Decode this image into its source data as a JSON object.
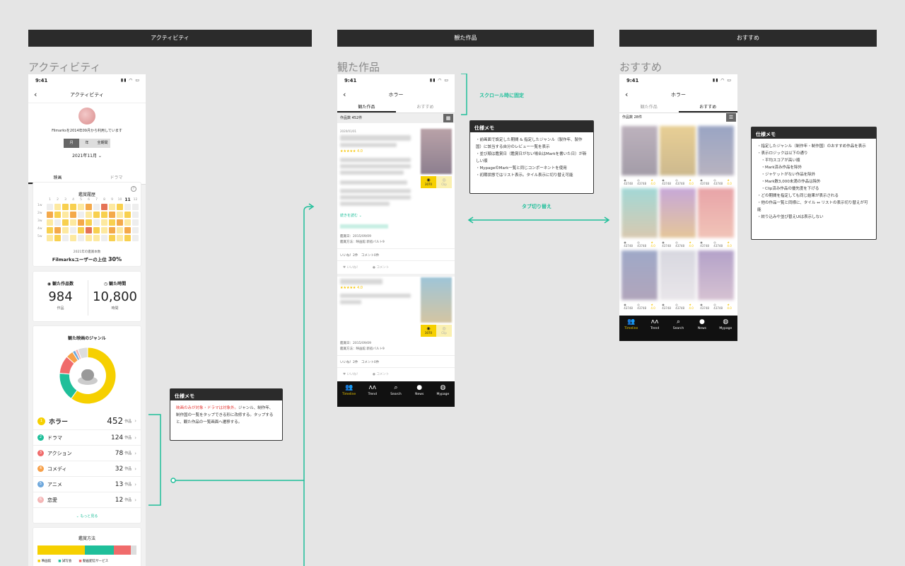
{
  "headers": [
    "アクティビティ",
    "観た作品",
    "おすすめ"
  ],
  "titles": [
    "アクティビティ",
    "観た作品",
    "おすすめ"
  ],
  "activity": {
    "time": "9:41",
    "nav_title": "アクティビティ",
    "since": "Filmarksを2014年09月から利用しています",
    "seg": [
      "月",
      "年",
      "全期間"
    ],
    "month": "2021年11月",
    "tabs": [
      "映画",
      "ドラマ"
    ],
    "calendar_title": "鑑賞履歴",
    "months": [
      "1",
      "2",
      "3",
      "4",
      "5",
      "6",
      "7",
      "8",
      "9",
      "10",
      "11",
      "12"
    ],
    "weeks": [
      "1w",
      "2w",
      "3w",
      "4w",
      "5w"
    ],
    "rank_caption": "2021年の鑑賞本数",
    "rank_text": "Filmarksユーザーの上位",
    "rank_value": "30%",
    "watched_label": "観た作品数",
    "watched_value": "984",
    "watched_unit": "作品",
    "time_label": "観た時間",
    "time_value": "10,800",
    "time_unit": "時間",
    "genre_title": "観た映画のジャンル",
    "genres": [
      {
        "rank": "1",
        "name": "ホラー",
        "count": "452",
        "unit": "作品",
        "color": "#f6d000"
      },
      {
        "rank": "2",
        "name": "ドラマ",
        "count": "124",
        "unit": "作品",
        "color": "#1fbf9a"
      },
      {
        "rank": "3",
        "name": "アクション",
        "count": "78",
        "unit": "作品",
        "color": "#f06b6b"
      },
      {
        "rank": "4",
        "name": "コメディ",
        "count": "32",
        "unit": "作品",
        "color": "#f7a14a"
      },
      {
        "rank": "5",
        "name": "アニメ",
        "count": "13",
        "unit": "作品",
        "color": "#6fa8dc"
      },
      {
        "rank": "6",
        "name": "恋愛",
        "count": "12",
        "unit": "作品",
        "color": "#f4b6b6"
      }
    ],
    "more": "もっと見る",
    "method_title": "鑑賞方法",
    "method_legend": [
      "映画館",
      "試写会",
      "動画配信サービス"
    ],
    "memo_title": "仕様メモ",
    "memo_red": "映画のみが対象・ドラマは対象外。",
    "memo_text": "ジャンル、制作年、制作国の一覧をタップできる形に改修する。タップすると、観た作品の一覧画面へ遷移する。"
  },
  "watched": {
    "time": "9:41",
    "nav_title": "ホラー",
    "tabs": [
      "観た作品",
      "おすすめ"
    ],
    "count": "作品数 452件",
    "item1_date": "2020/01/01",
    "item1_score": "4.0",
    "read_more": "続きを読む",
    "item1_meta1": "鑑賞日：2015/09/09",
    "item1_meta2": "鑑賞方法：映画館 新宿バルト9",
    "item1_likes": "いいね！2件　コメント0件",
    "like": "いいね！",
    "comment": "コメント",
    "item2_score": "4.0",
    "item2_meta1": "鑑賞日：2015/09/09",
    "item2_meta2": "鑑賞方法：映画館 新宿バルト9",
    "item2_likes": "いいね！2件　コメント0件",
    "mark_count": "3070",
    "clip_label": "Clip",
    "annotation_fixed": "スクロール時に固定",
    "annotation_tab": "タブ切り替え",
    "memo_title": "仕様メモ",
    "memo_lines": [
      "・前画面で設定した期間 & 指定したジャンル（製作年、製作国）に該当する自分のレビュー一覧を表示",
      "・並び順は鑑賞日（鑑賞日がない場合はMarkを書いた日）が新しい順",
      "・MypageのMark一覧と同じコンポーネントを使用",
      "・初期状態ではリスト表示。タイル表示に切り替え可能"
    ]
  },
  "recommend": {
    "time": "9:41",
    "nav_title": "ホラー",
    "tabs": [
      "観た作品",
      "おすすめ"
    ],
    "count": "作品数 28件",
    "memo_title": "仕様メモ",
    "memo_lines": [
      "・指定したジャンル（制作年・制作国）のおすすめ作品を表示",
      "・表示ロジックは以下の通り",
      "　・平均スコアが高い順",
      "　・Mark済み作品を除外",
      "　・ジャケットがない作品を除外",
      "　・Mark数3,000未満の作品は除外",
      "　・Clip済み作品の優先度を下げる",
      "・どの期間を指定しても同じ結果が表示される",
      "・他の作品一覧と同様に、タイル ↔ リストの表示切り替えが可能",
      "・絞り込みや並び替えUIは表示しない"
    ],
    "tile_stat": "43748",
    "tile_score": "4.0"
  },
  "bottom_nav": [
    "Timeline",
    "Trend",
    "Search",
    "News",
    "Mypage"
  ],
  "colors": {
    "accent": "#1fbf9a",
    "yellow": "#f6d000",
    "dark": "#2b2b2b"
  }
}
